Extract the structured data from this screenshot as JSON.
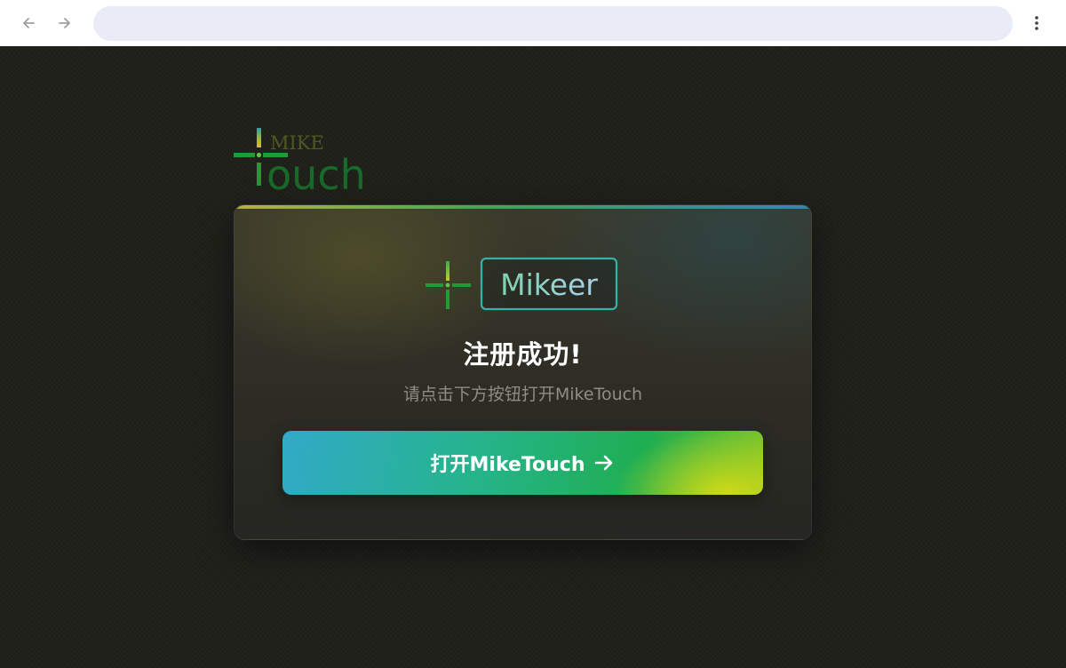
{
  "browser": {
    "address": "",
    "icons": {
      "back": "arrow-left-icon",
      "forward": "arrow-right-icon",
      "menu": "vertical-dots-icon"
    }
  },
  "brand": {
    "logo_small_text": "MIKE",
    "logo_large_text": "ouch"
  },
  "card": {
    "logo_label": "Mikeer",
    "title": "注册成功!",
    "subtitle": "请点击下方按钮打开MikeTouch",
    "button_label": "打开MikeTouch",
    "button_icon": "arrow-right-icon"
  },
  "colors": {
    "brand_green": "#1f9c35",
    "dark_green": "#186b2a",
    "olive": "#4d5a24",
    "teal": "#36b1a8",
    "background": "#21211c"
  }
}
